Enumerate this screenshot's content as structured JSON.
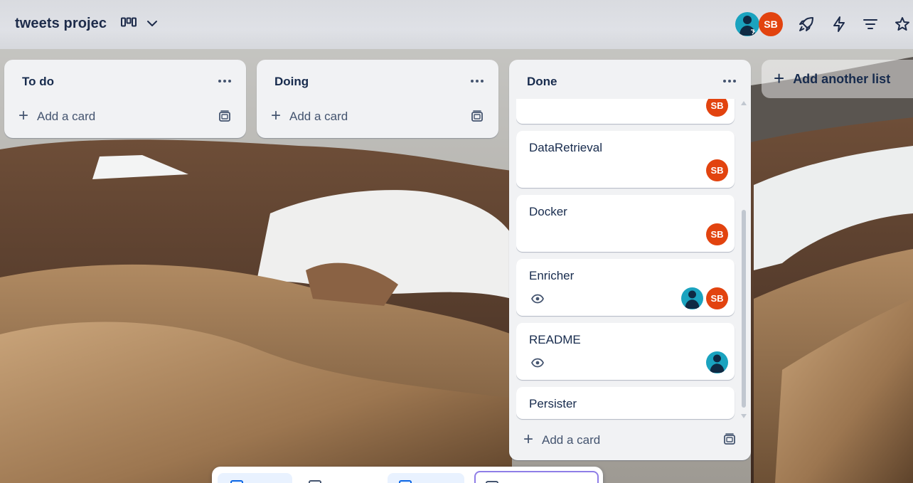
{
  "board": {
    "title": "tweets projec",
    "view_icon": "board-columns-icon",
    "view_dropdown_icon": "chevron-down-icon"
  },
  "header": {
    "member_avatars": [
      {
        "kind": "person",
        "icon": "user-avatar-icon"
      },
      {
        "kind": "initials",
        "initials": "SB"
      }
    ],
    "icons": [
      "power-ups-rocket-icon",
      "automation-bolt-icon",
      "filter-icon",
      "star-icon"
    ]
  },
  "lists": [
    {
      "title": "To do",
      "add_card_label": "Add a card"
    },
    {
      "title": "Doing",
      "add_card_label": "Add a card"
    },
    {
      "title": "Done",
      "add_card_label": "Add a card",
      "cards": [
        {
          "title": "",
          "members": [
            "SB"
          ],
          "watching": false
        },
        {
          "title": "DataRetrieval",
          "members": [
            "SB"
          ],
          "watching": false
        },
        {
          "title": "Docker",
          "members": [
            "SB"
          ],
          "watching": false
        },
        {
          "title": "Enricher",
          "members": [
            "person",
            "SB"
          ],
          "watching": true
        },
        {
          "title": "README",
          "members": [
            "person"
          ],
          "watching": true
        },
        {
          "title": "Persister",
          "members": [],
          "watching": false
        }
      ]
    }
  ],
  "add_list_label": "Add another list",
  "colors": {
    "avatar_sb": "#e2430f",
    "avatar_person": "#1aa3bf",
    "list_bg": "#f1f2f4",
    "text": "#172b4d"
  }
}
